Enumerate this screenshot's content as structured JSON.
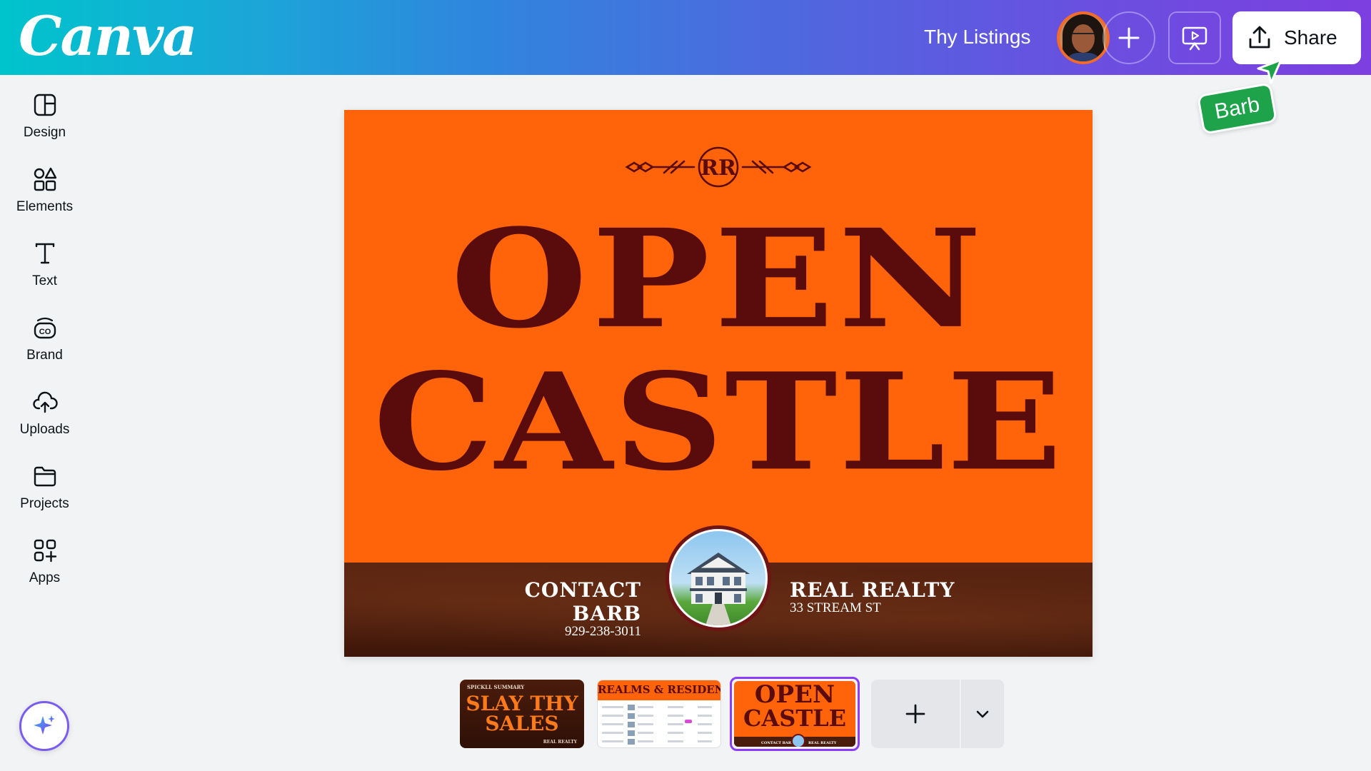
{
  "app": {
    "logo_text": "Canva",
    "design_title": "Thy Listings"
  },
  "header": {
    "add_collaborator_icon": "plus-icon",
    "present_icon": "present-icon",
    "share_label": "Share",
    "share_icon": "upload-icon"
  },
  "collaborator_cursor": {
    "name": "Barb",
    "color": "#1ea24a"
  },
  "sidebar": {
    "items": [
      {
        "label": "Design",
        "icon": "layout-icon"
      },
      {
        "label": "Elements",
        "icon": "shapes-icon"
      },
      {
        "label": "Text",
        "icon": "text-icon"
      },
      {
        "label": "Brand",
        "icon": "brand-icon"
      },
      {
        "label": "Uploads",
        "icon": "cloud-upload-icon"
      },
      {
        "label": "Projects",
        "icon": "folder-icon"
      },
      {
        "label": "Apps",
        "icon": "apps-icon"
      }
    ],
    "magic_icon": "sparkle-icon"
  },
  "canvas": {
    "monogram": "RR",
    "headline_line1": "OPEN",
    "headline_line2": "CASTLE",
    "contact_title": "CONTACT  BARB",
    "contact_phone": "929-238-3011",
    "company_title": "REAL REALTY",
    "company_address": "33 STREAM ST",
    "background_color": "#ff640a",
    "text_color": "#5a0b0b"
  },
  "pages": [
    {
      "title_line1": "SLAY THY",
      "title_line2": "SALES",
      "small_left": "SPICKLL SUMMARY",
      "small_right": "REAL REALTY"
    },
    {
      "title": "REALMS & RESIDENCE"
    },
    {
      "title_line1": "OPEN",
      "title_line2": "CASTLE",
      "small_left": "CONTACT BARB",
      "small_right": "REAL REALTY",
      "selected": true
    }
  ],
  "page_controls": {
    "add_icon": "plus-icon",
    "expand_icon": "chevron-down-icon"
  },
  "accent_color": "#8b3dff"
}
